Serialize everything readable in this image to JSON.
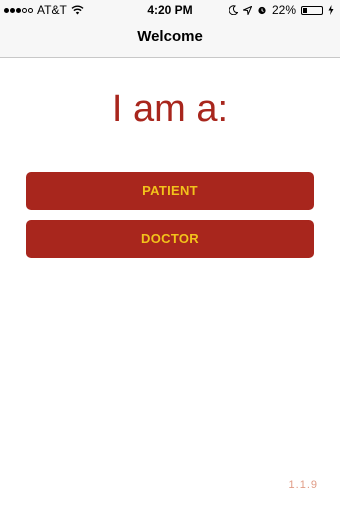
{
  "status_bar": {
    "carrier": "AT&T",
    "time": "4:20 PM",
    "battery_percent": "22%",
    "battery_level": 0.22,
    "icons": [
      "signal-dots-icon",
      "wifi-icon",
      "moon-icon",
      "location-arrow-icon",
      "alarm-clock-icon",
      "battery-icon",
      "charging-bolt-icon"
    ]
  },
  "nav": {
    "title": "Welcome"
  },
  "main": {
    "heading": "I am a:",
    "buttons": {
      "patient_label": "PATIENT",
      "doctor_label": "DOCTOR"
    },
    "version": "1.1.9"
  },
  "colors": {
    "accent": "#a8261d",
    "button_text": "#f2c21b",
    "version_text": "#e09b85"
  }
}
